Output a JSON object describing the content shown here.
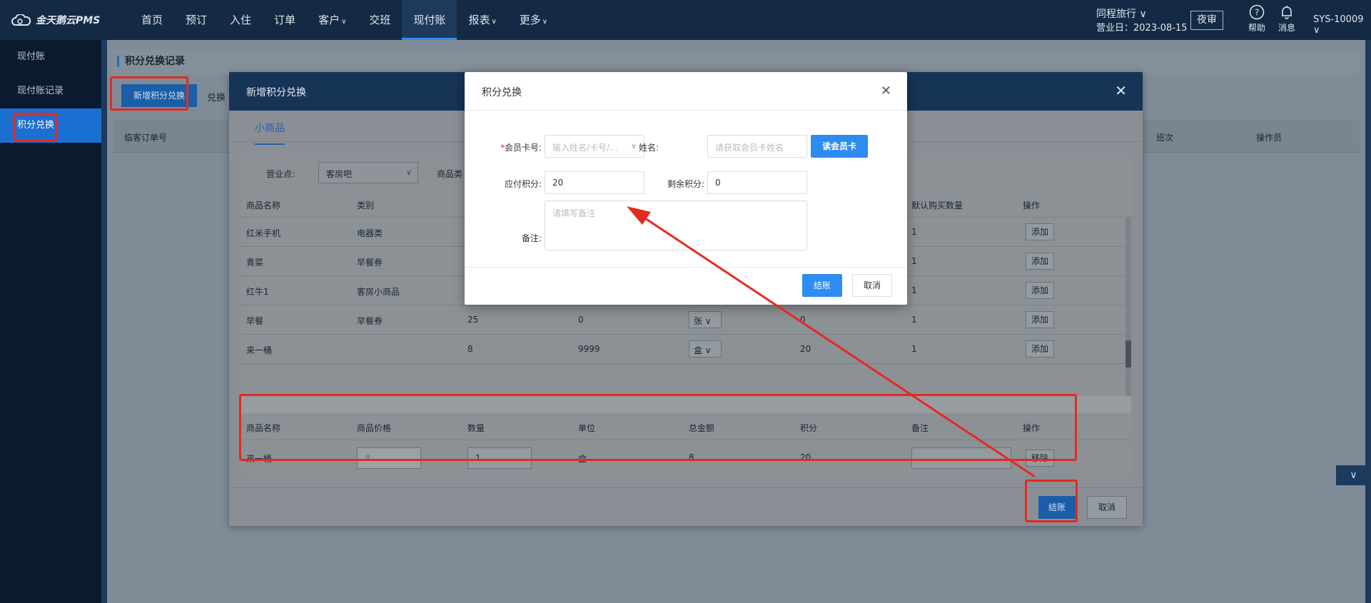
{
  "app": {
    "logo": "金天鹅云PMS"
  },
  "nav": [
    {
      "label": "首页"
    },
    {
      "label": "预订"
    },
    {
      "label": "入住"
    },
    {
      "label": "订单"
    },
    {
      "label": "客户",
      "caret": "∨"
    },
    {
      "label": "交班"
    },
    {
      "label": "现付账",
      "active": true
    },
    {
      "label": "报表",
      "caret": "∨"
    },
    {
      "label": "更多",
      "caret": "∨"
    }
  ],
  "header": {
    "hotel": "同程旅行 ∨",
    "business_date": "营业日：2023-08-15",
    "night_audit": "夜审",
    "help": "帮助",
    "messages": "消息",
    "user": "SYS-10009 ∨"
  },
  "sidebar": [
    {
      "label": "现付账"
    },
    {
      "label": "现付账记录"
    },
    {
      "label": "积分兑换",
      "active": true
    }
  ],
  "page": {
    "title": "积分兑换记录",
    "new_button": "新增积分兑换",
    "tab2": "兑换",
    "bg_columns": {
      "c1": "临客订单号",
      "c2": "班次",
      "c3": "操作员"
    }
  },
  "modal": {
    "title": "新增积分兑换",
    "tab": "小商品",
    "filter": {
      "outlet_label": "营业点:",
      "outlet_value": "客房吧",
      "category_label": "商品类"
    },
    "columns": {
      "name": "商品名称",
      "category": "类别",
      "default_qty": "默认购买数量",
      "action": "操作"
    },
    "rows": [
      {
        "name": "红米手机",
        "category": "电器类",
        "c3": "",
        "c4": "",
        "unit": "",
        "c6": "",
        "qty": "1"
      },
      {
        "name": "青菜",
        "category": "早餐券",
        "c3": "",
        "c4": "",
        "unit": "",
        "c6": "",
        "qty": "1"
      },
      {
        "name": "红牛1",
        "category": "客房小商品",
        "c3": "",
        "c4": "",
        "unit": "",
        "c6": "",
        "qty": "1"
      },
      {
        "name": "早餐",
        "category": "早餐券",
        "c3": "25",
        "c4": "0",
        "unit": "张 ∨",
        "c6": "0",
        "qty": "1"
      },
      {
        "name": "来一桶",
        "category": "",
        "c3": "8",
        "c4": "9999",
        "unit": "盒 ∨",
        "c6": "20",
        "qty": "1"
      }
    ],
    "add_label": "添加",
    "cart_columns": {
      "name": "商品名称",
      "price": "商品价格",
      "qty": "数量",
      "unit": "单位",
      "total": "总金额",
      "points": "积分",
      "remark": "备注",
      "action": "操作"
    },
    "cart_row": {
      "name": "来一桶",
      "price": "8",
      "qty": "1",
      "unit": "盒",
      "total": "8",
      "points": "20",
      "remark": ""
    },
    "remove_label": "移除",
    "ok": "结账",
    "cancel": "取消"
  },
  "dialog": {
    "title": "积分兑换",
    "card_label": "会员卡号:",
    "card_required": "*",
    "card_placeholder": "输入姓名/卡号/...",
    "name_label": "姓名:",
    "name_placeholder": "请获取会员卡姓名",
    "read_card": "读会员卡",
    "due_label": "应付积分:",
    "due_value": "20",
    "remain_label": "剩余积分:",
    "remain_value": "0",
    "remark_label": "备注:",
    "remark_placeholder": "请填写备注",
    "ok": "结账",
    "cancel": "取消"
  },
  "colors": {
    "primary": "#2d8cf0",
    "annotation": "#e52a1f",
    "header": "#142a44"
  }
}
